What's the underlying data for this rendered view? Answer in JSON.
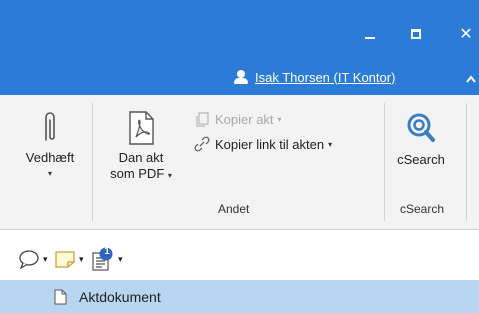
{
  "window": {
    "minimize_icon": "minimize-icon",
    "maximize_icon": "maximize-icon",
    "close_icon": "close-icon",
    "close_glyph": "✕",
    "accent_color": "#2b7bd7"
  },
  "user": {
    "name": "Isak Thorsen (IT Kontor)",
    "icon": "user-icon"
  },
  "ribbon": {
    "attach": {
      "label": "Vedhæft",
      "arrow": "▾",
      "icon": "paperclip-icon"
    },
    "pdf": {
      "label_line1": "Dan akt",
      "label_line2": "som PDF",
      "arrow": "▾",
      "icon": "pdf-icon"
    },
    "copy_act": {
      "label": "Kopier akt",
      "arrow": "▾",
      "icon": "copy-icon",
      "disabled": true
    },
    "copy_link": {
      "label": "Kopier link til akten",
      "arrow": "▾",
      "icon": "link-icon"
    },
    "group_andet": "Andet",
    "csearch": {
      "label": "cSearch",
      "icon": "csearch-icon"
    },
    "group_csearch": "cSearch"
  },
  "quick_access": {
    "comment": {
      "icon": "speech-bubble-icon",
      "arrow": "▾"
    },
    "note": {
      "icon": "sticky-note-icon",
      "arrow": "▾"
    },
    "list": {
      "icon": "numbered-list-icon",
      "badge": "1",
      "arrow": "▾"
    }
  },
  "documents": [
    {
      "label": "Aktdokument",
      "icon": "document-icon",
      "selected": true
    }
  ]
}
